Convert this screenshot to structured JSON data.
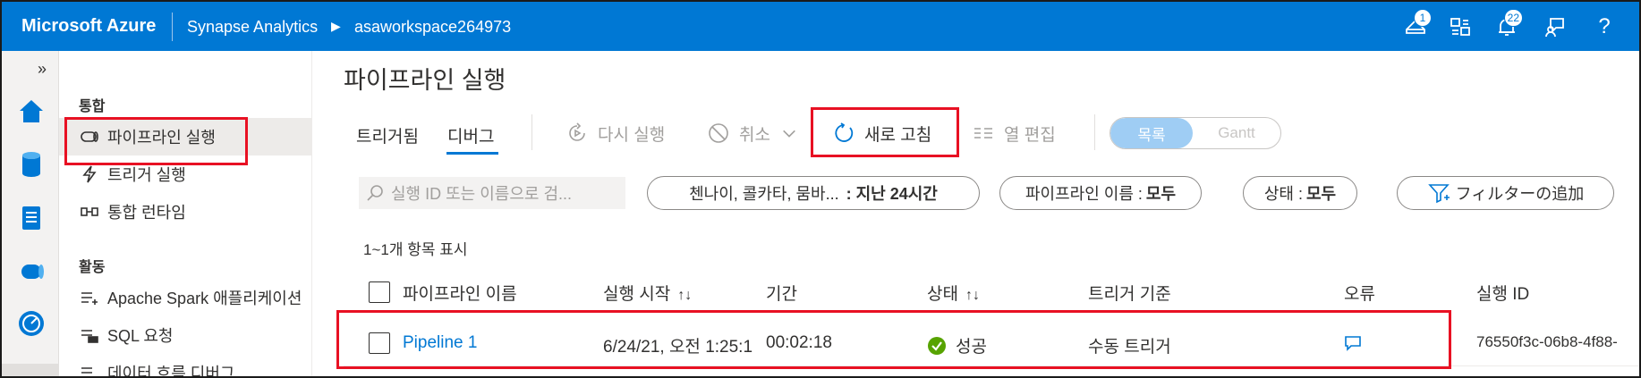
{
  "topbar": {
    "brand": "Microsoft Azure",
    "crumb1": "Synapse Analytics",
    "crumb_separator": "▶",
    "crumb2": "asaworkspace264973",
    "icons": [
      {
        "name": "notifications-feed-icon",
        "badge": "1"
      },
      {
        "name": "directory-switch-icon",
        "badge": ""
      },
      {
        "name": "bell-icon",
        "badge": "22"
      },
      {
        "name": "feedback-icon",
        "badge": ""
      },
      {
        "name": "help-icon",
        "label": "?"
      }
    ],
    "color": "#0078d4"
  },
  "rail": {
    "expand": "»",
    "icons": [
      "home-icon",
      "data-icon",
      "develop-icon",
      "integrate-icon",
      "monitor-icon"
    ]
  },
  "nav": {
    "section1": "통합",
    "items1": [
      {
        "label": "파이프라인 실행",
        "icon": "pipeline-icon"
      },
      {
        "label": "트리거 실행",
        "icon": "trigger-icon"
      },
      {
        "label": "통합 런타임",
        "icon": "runtime-icon"
      }
    ],
    "section2": "활동",
    "items2": [
      {
        "label": "Apache Spark 애플리케이션",
        "icon": "spark-icon"
      },
      {
        "label": "SQL 요청",
        "icon": "sql-icon"
      },
      {
        "label": "데이터 흐름 디버그",
        "icon": "dataflow-icon"
      }
    ]
  },
  "main": {
    "title": "파이프라인 실행",
    "tabs": [
      "트리거됨",
      "디버그"
    ],
    "commands": {
      "rerun": "다시 실행",
      "cancel": "취소",
      "refresh": "새로 고침",
      "edit_columns": "열 편집"
    },
    "view_toggle": {
      "list": "목록",
      "gantt": "Gantt"
    },
    "search_placeholder": "실행 ID 또는 이름으로 검...",
    "filters": {
      "time_prefix": "첸나이, 콜카타, 뭄바...",
      "time_value": ": 지난 24시간",
      "pipeline_prefix": "파이프라인 이름 : ",
      "pipeline_value": "모두",
      "status_prefix": "상태 : ",
      "status_value": "모두",
      "add_filter": "フィルターの追加"
    },
    "count_text": "1~1개 항목 표시",
    "columns": [
      "파이프라인 이름",
      "실행 시작",
      "기간",
      "상태",
      "트리거 기준",
      "오류",
      "실행 ID"
    ],
    "sort_glyph": "↑↓",
    "rows": [
      {
        "pipeline_name": "Pipeline 1",
        "run_start": "6/24/21, 오전 1:25:1",
        "duration": "00:02:18",
        "status": "성공",
        "triggered_by": "수동 트리거",
        "run_id": "76550f3c-06b8-4f88-"
      }
    ]
  },
  "colors": {
    "accent": "#0078d4",
    "success": "#57a300",
    "highlight": "#e81123"
  }
}
